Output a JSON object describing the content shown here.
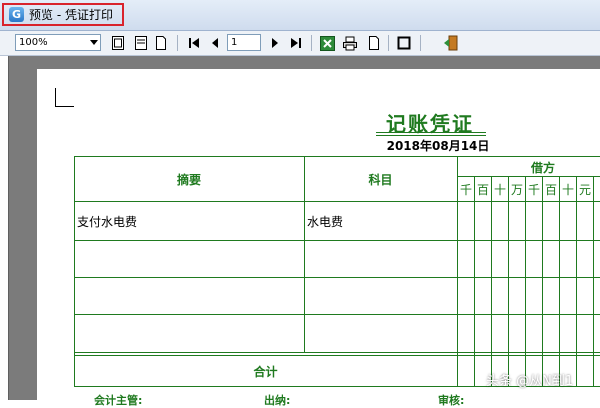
{
  "window": {
    "title": "预览 - 凭证打印"
  },
  "toolbar": {
    "zoom_value": "100%",
    "page_number": "1"
  },
  "voucher": {
    "title": "记账凭证",
    "date": "2018年08月14日",
    "col_summary": "摘要",
    "col_account": "科目",
    "col_debit": "借方",
    "digit_headers": [
      "千",
      "百",
      "十",
      "万",
      "千",
      "百",
      "十",
      "元"
    ],
    "rows": [
      {
        "summary": "支付水电费",
        "account": "水电费"
      },
      {
        "summary": "",
        "account": ""
      },
      {
        "summary": "",
        "account": ""
      },
      {
        "summary": "",
        "account": ""
      }
    ],
    "total_label": "合计",
    "footer": {
      "supervisor": "会计主管:",
      "cashier": "出纳:",
      "reviewer": "审核:"
    }
  },
  "watermark": "头条 @从N到1",
  "colors": {
    "ink_green": "#1f7a1f",
    "highlight_red": "#d9232c",
    "viewer_gray": "#7b7b7b"
  }
}
